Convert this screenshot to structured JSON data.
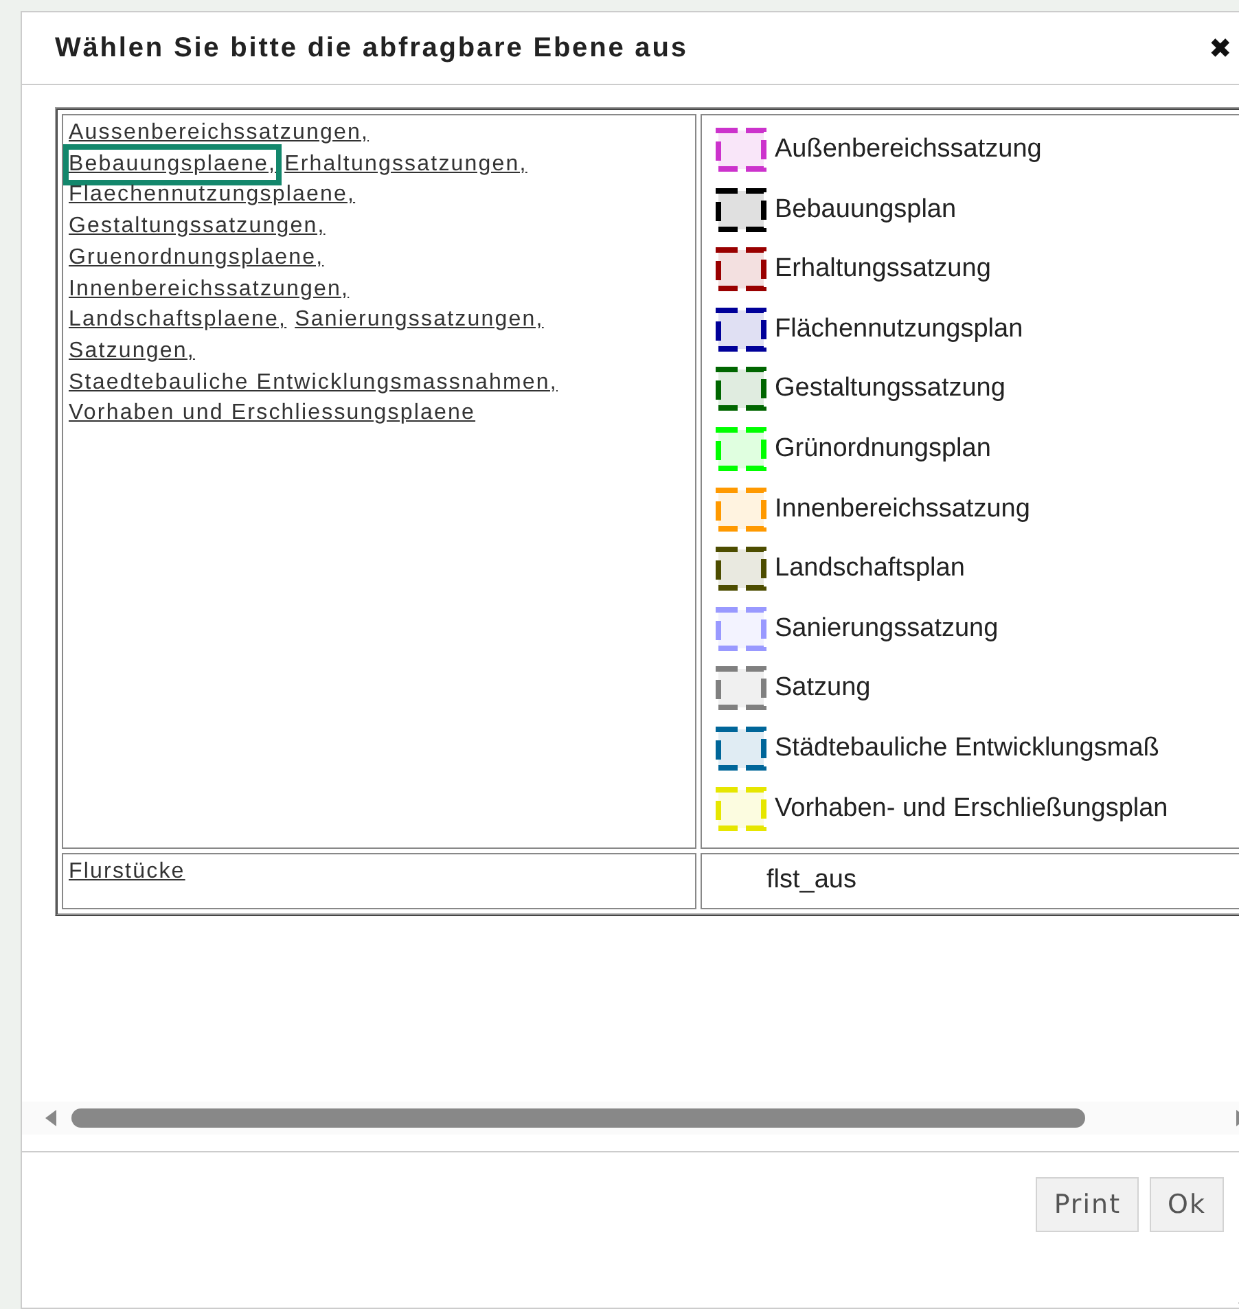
{
  "dialog": {
    "title": "Wählen Sie bitte die abfragbare Ebene aus",
    "close": "✖"
  },
  "layers": {
    "link_lines": [
      [
        {
          "label": "Aussenbereichssatzungen,",
          "highlighted": false
        }
      ],
      [
        {
          "label": "Bebauungsplaene,",
          "highlighted": true
        },
        {
          "label": "Erhaltungssatzungen,",
          "highlighted": false
        }
      ],
      [
        {
          "label": "Flaechennutzungsplaene,",
          "highlighted": false
        }
      ],
      [
        {
          "label": "Gestaltungssatzungen,",
          "highlighted": false
        }
      ],
      [
        {
          "label": "Gruenordnungsplaene,",
          "highlighted": false
        }
      ],
      [
        {
          "label": "Innenbereichssatzungen,",
          "highlighted": false
        }
      ],
      [
        {
          "label": "Landschaftsplaene,",
          "highlighted": false
        },
        {
          "label": "Sanierungssatzungen,",
          "highlighted": false
        }
      ],
      [
        {
          "label": "Satzungen,",
          "highlighted": false
        }
      ],
      [
        {
          "label": "Staedtebauliche Entwicklungsmassnahmen,",
          "highlighted": false
        }
      ],
      [
        {
          "label": "Vorhaben und Erschliessungsplaene",
          "highlighted": false
        }
      ]
    ],
    "legend": [
      {
        "label": "Außenbereichssatzung",
        "color": "#cc33cc"
      },
      {
        "label": "Bebauungsplan",
        "color": "#000000"
      },
      {
        "label": "Erhaltungssatzung",
        "color": "#990000"
      },
      {
        "label": "Flächennutzungsplan",
        "color": "#000099"
      },
      {
        "label": "Gestaltungssatzung",
        "color": "#006600"
      },
      {
        "label": "Grünordnungsplan",
        "color": "#00ff00"
      },
      {
        "label": "Innenbereichssatzung",
        "color": "#ff9900"
      },
      {
        "label": "Landschaftsplan",
        "color": "#4d4d00"
      },
      {
        "label": "Sanierungssatzung",
        "color": "#9999ff"
      },
      {
        "label": "Satzung",
        "color": "#808080"
      },
      {
        "label": "Städtebauliche Entwicklungsmaß",
        "color": "#006699"
      },
      {
        "label": "Vorhaben- und Erschließungsplan",
        "color": "#e6e600"
      }
    ],
    "second_row": {
      "link": "Flurstücke",
      "value": "flst_aus"
    }
  },
  "buttons": [
    "Print",
    "Ok"
  ]
}
